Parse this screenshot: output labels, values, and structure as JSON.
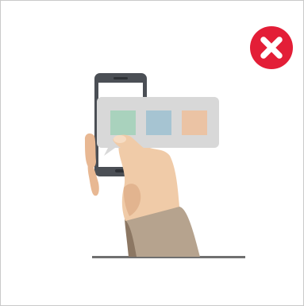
{
  "close_button": {
    "icon": "close-icon",
    "color": "#e31e37"
  },
  "illustration": {
    "subject": "hand-holding-smartphone-with-swatch-popup",
    "swatch_colors": [
      "#a9d2bd",
      "#a6c4d2",
      "#ebc3a4"
    ],
    "popup_color": "#d8d8d8",
    "phone_color": "#4b4f55",
    "skin_color": "#f0cba8",
    "sleeve_color": "#b6a38e"
  }
}
